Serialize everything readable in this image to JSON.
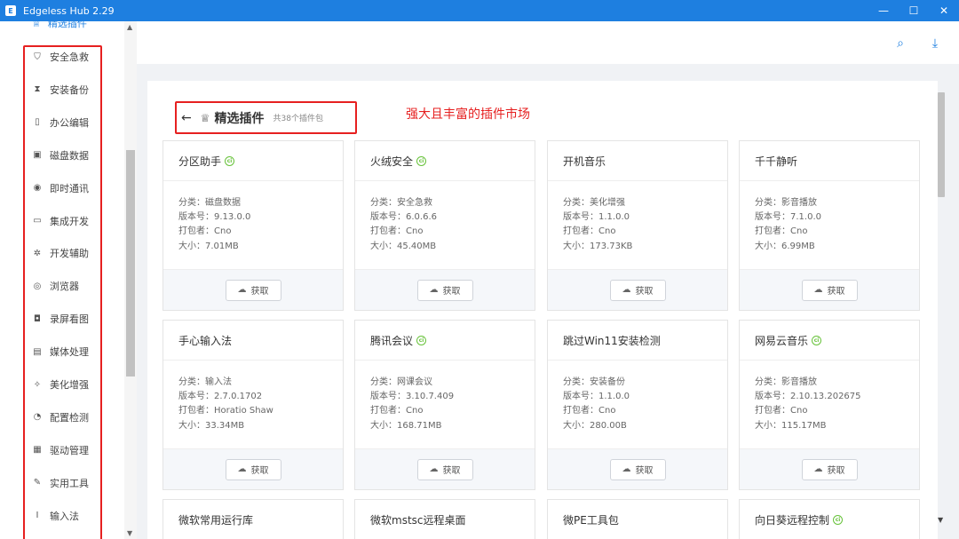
{
  "window": {
    "title": "Edgeless Hub 2.29",
    "logo_text": "E",
    "controls": {
      "minimize": "—",
      "maximize": "☐",
      "close": "✕"
    }
  },
  "sidebar": {
    "active_item": "精选插件",
    "items": [
      {
        "label": "安全急救",
        "icon": "shield-icon",
        "glyph": "⛉"
      },
      {
        "label": "安装备份",
        "icon": "hourglass-icon",
        "glyph": "⧗"
      },
      {
        "label": "办公编辑",
        "icon": "document-icon",
        "glyph": "▯"
      },
      {
        "label": "磁盘数据",
        "icon": "disk-icon",
        "glyph": "▣"
      },
      {
        "label": "即时通讯",
        "icon": "chat-icon",
        "glyph": "◉"
      },
      {
        "label": "集成开发",
        "icon": "terminal-icon",
        "glyph": "▭"
      },
      {
        "label": "开发辅助",
        "icon": "bug-icon",
        "glyph": "✲"
      },
      {
        "label": "浏览器",
        "icon": "browser-icon",
        "glyph": "◎"
      },
      {
        "label": "录屏看图",
        "icon": "camera-icon",
        "glyph": "◘"
      },
      {
        "label": "媒体处理",
        "icon": "media-icon",
        "glyph": "▤"
      },
      {
        "label": "美化增强",
        "icon": "magic-icon",
        "glyph": "✧"
      },
      {
        "label": "配置检测",
        "icon": "gauge-icon",
        "glyph": "◔"
      },
      {
        "label": "驱动管理",
        "icon": "chip-icon",
        "glyph": "▦"
      },
      {
        "label": "实用工具",
        "icon": "wrench-icon",
        "glyph": "✎"
      },
      {
        "label": "输入法",
        "icon": "italic-icon",
        "glyph": "I"
      }
    ]
  },
  "header": {
    "search_icon": "⌕",
    "download_icon": "⤓"
  },
  "main": {
    "back_glyph": "←",
    "trophy_glyph": "♕",
    "title": "精选插件",
    "count": "共38个插件包",
    "tagline": "强大且丰富的插件市场",
    "get_label": "获取",
    "cloud_glyph": "☁",
    "badge_glyph": "ci",
    "cards": [
      {
        "name": "分区助手",
        "badge": true,
        "category": "分类：磁盘数据",
        "version": "版本号：9.13.0.0",
        "packer": "打包者：Cno",
        "size": "大小：7.01MB"
      },
      {
        "name": "火绒安全",
        "badge": true,
        "category": "分类：安全急救",
        "version": "版本号：6.0.6.6",
        "packer": "打包者：Cno",
        "size": "大小：45.40MB"
      },
      {
        "name": "开机音乐",
        "badge": false,
        "category": "分类：美化增强",
        "version": "版本号：1.1.0.0",
        "packer": "打包者：Cno",
        "size": "大小：173.73KB"
      },
      {
        "name": "千千静听",
        "badge": false,
        "category": "分类：影音播放",
        "version": "版本号：7.1.0.0",
        "packer": "打包者：Cno",
        "size": "大小：6.99MB"
      },
      {
        "name": "手心输入法",
        "badge": false,
        "category": "分类：输入法",
        "version": "版本号：2.7.0.1702",
        "packer": "打包者：Horatio Shaw",
        "size": "大小：33.34MB"
      },
      {
        "name": "腾讯会议",
        "badge": true,
        "category": "分类：网课会议",
        "version": "版本号：3.10.7.409",
        "packer": "打包者：Cno",
        "size": "大小：168.71MB"
      },
      {
        "name": "跳过Win11安装检测",
        "badge": false,
        "category": "分类：安装备份",
        "version": "版本号：1.1.0.0",
        "packer": "打包者：Cno",
        "size": "大小：280.00B"
      },
      {
        "name": "网易云音乐",
        "badge": true,
        "category": "分类：影音播放",
        "version": "版本号：2.10.13.202675",
        "packer": "打包者：Cno",
        "size": "大小：115.17MB"
      },
      {
        "name": "微软常用运行库",
        "badge": false
      },
      {
        "name": "微软mstsc远程桌面",
        "badge": false
      },
      {
        "name": "微PE工具包",
        "badge": false
      },
      {
        "name": "向日葵远程控制",
        "badge": true
      }
    ]
  },
  "colors": {
    "accent": "#1e7fe0",
    "highlight_border": "#e62020",
    "badge_green": "#67c23a"
  }
}
